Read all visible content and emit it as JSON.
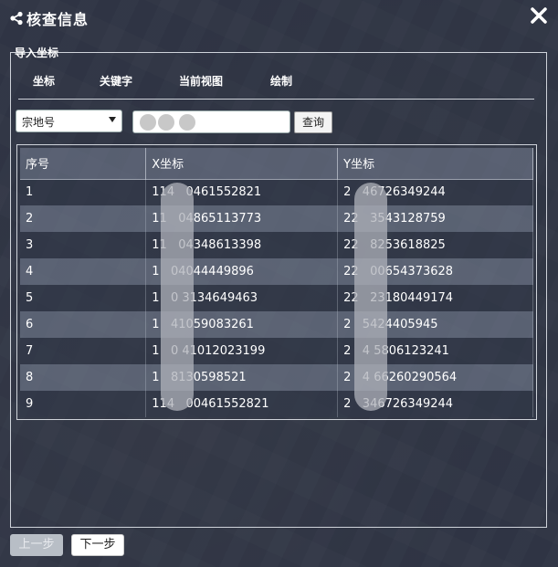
{
  "dialog": {
    "title": "核查信息",
    "close_label": "✕"
  },
  "section": {
    "legend": "导入坐标"
  },
  "tabs": [
    {
      "label": "坐标"
    },
    {
      "label": "关键字"
    },
    {
      "label": "当前视图"
    },
    {
      "label": "绘制"
    }
  ],
  "search": {
    "select_value": "宗地号",
    "input_value": "0   0",
    "query_label": "查询"
  },
  "table": {
    "headers": [
      "序号",
      "X坐标",
      "Y坐标"
    ],
    "rows": [
      [
        "1",
        "114   0461552821",
        "2   46726349244"
      ],
      [
        "2",
        "11   04865113773",
        "22   3543128759"
      ],
      [
        "3",
        "11   04348613398",
        "22   8253618825"
      ],
      [
        "4",
        "1   04044449896",
        "22   00654373628"
      ],
      [
        "5",
        "1   0 3134649463",
        "22   23180449174"
      ],
      [
        "6",
        "1   41059083261",
        "2   5424405945"
      ],
      [
        "7",
        "1   0 41012023199",
        "2   4 5806123241"
      ],
      [
        "8",
        "1   8130598521",
        "2   4 66260290564"
      ],
      [
        "9",
        "114   00461552821",
        "2   346726349244"
      ]
    ]
  },
  "footer": {
    "prev_label": "上一步",
    "next_label": "下一步"
  }
}
